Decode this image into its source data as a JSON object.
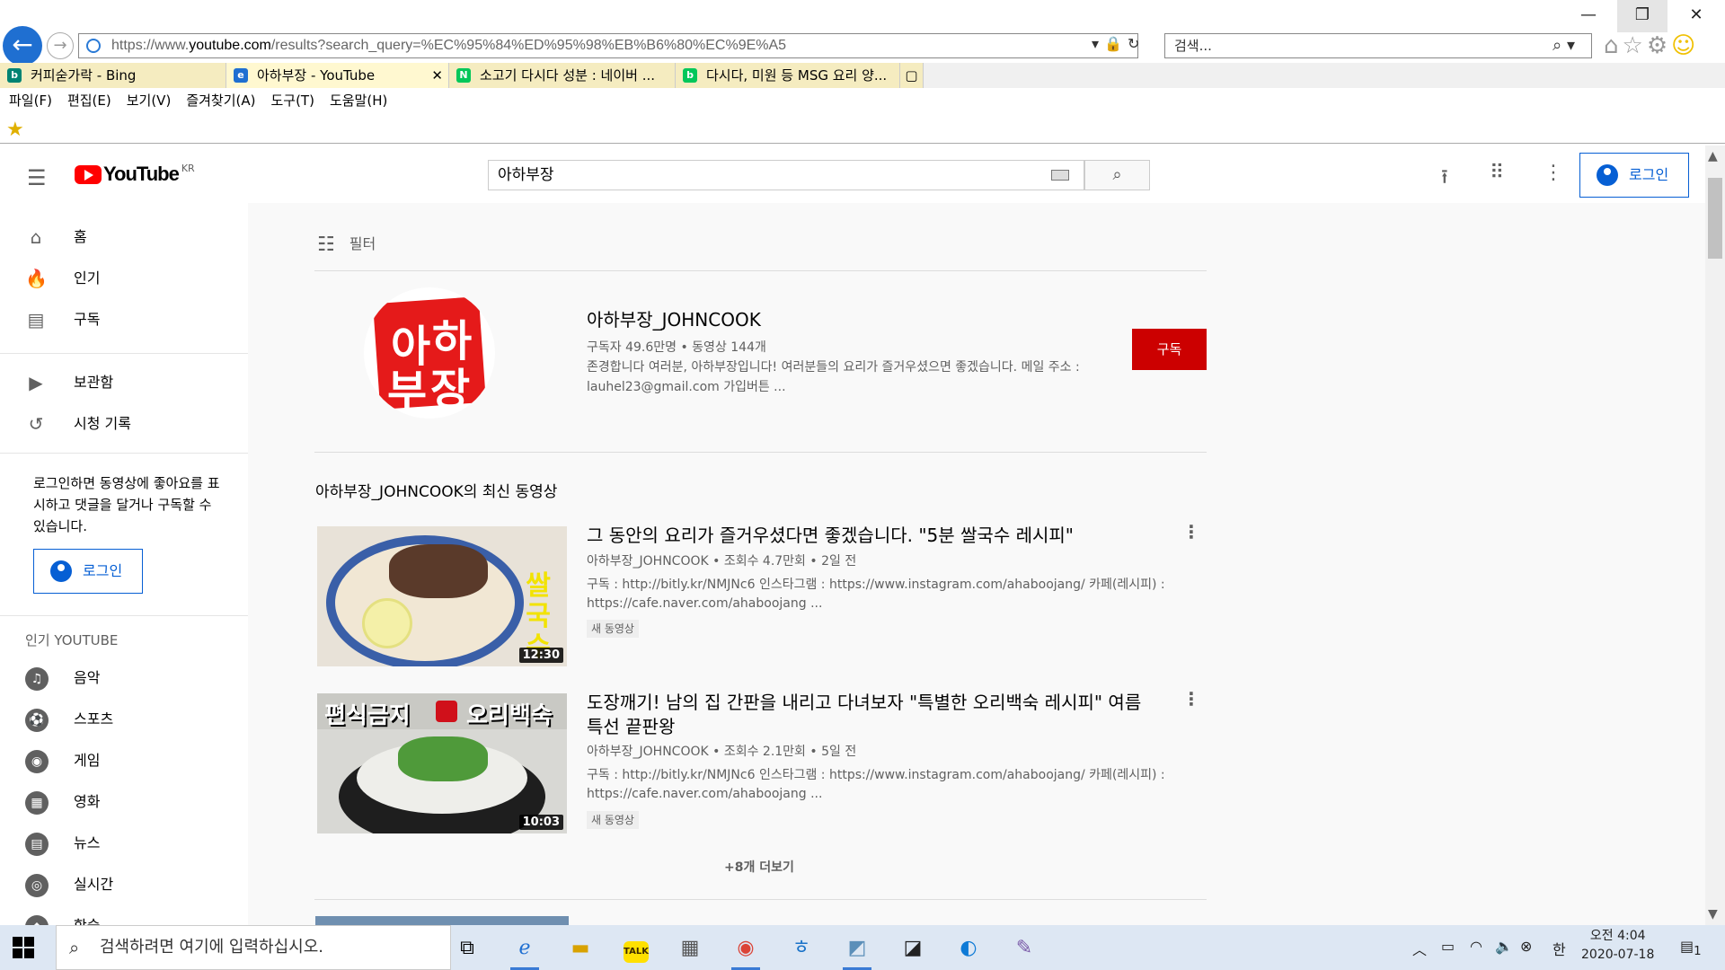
{
  "browser": {
    "url": "https://www.youtube.com/results?search_query=%EC%95%84%ED%95%98%EB%B6%80%EC%9E%A5",
    "url_scheme": "https://www.",
    "url_domain": "youtube.com",
    "url_path": "/results?search_query=%EC%95%84%ED%95%98%EB%B6%80%EC%9E%A5",
    "search_placeholder": "검색...",
    "tabs": [
      {
        "label": "커피숟가락 - Bing",
        "icon": "bing-icon",
        "color": "#008373"
      },
      {
        "label": "아하부장 - YouTube",
        "icon": "ie-icon",
        "color": "#1f6fd1"
      },
      {
        "label": "소고기 다시다 성분 : 네이버 ...",
        "icon": "naver-icon",
        "color": "#03c75a"
      },
      {
        "label": "다시다, 미원 등 MSG 요리 양...",
        "icon": "blog-icon",
        "color": "#03c75a"
      }
    ],
    "menu": [
      "파일(F)",
      "편집(E)",
      "보기(V)",
      "즐겨찾기(A)",
      "도구(T)",
      "도움말(H)"
    ]
  },
  "youtube": {
    "logo_text": "YouTube",
    "region": "KR",
    "search_value": "아하부장",
    "login_label": "로그인",
    "guide": {
      "main": [
        {
          "label": "홈",
          "icon": "home-icon",
          "glyph": "⌂"
        },
        {
          "label": "인기",
          "icon": "flame-icon",
          "glyph": "🔥"
        },
        {
          "label": "구독",
          "icon": "subscriptions-icon",
          "glyph": "▤"
        }
      ],
      "library": [
        {
          "label": "보관함",
          "icon": "library-icon",
          "glyph": "▶"
        },
        {
          "label": "시청 기록",
          "icon": "history-icon",
          "glyph": "↺"
        }
      ],
      "login_prompt": "로그인하면 동영상에 좋아요를 표시하고 댓글을 달거나 구독할 수 있습니다.",
      "login_label": "로그인",
      "popular_heading": "인기 YOUTUBE",
      "popular": [
        {
          "label": "음악",
          "icon": "music-icon",
          "glyph": "♫"
        },
        {
          "label": "스포츠",
          "icon": "sports-icon",
          "glyph": "⚽"
        },
        {
          "label": "게임",
          "icon": "gaming-icon",
          "glyph": "◉"
        },
        {
          "label": "영화",
          "icon": "movies-icon",
          "glyph": "▦"
        },
        {
          "label": "뉴스",
          "icon": "news-icon",
          "glyph": "▤"
        },
        {
          "label": "실시간",
          "icon": "live-icon",
          "glyph": "◎"
        },
        {
          "label": "학습",
          "icon": "learning-icon",
          "glyph": "◆"
        }
      ]
    },
    "filter_label": "필터",
    "channel": {
      "name": "아하부장_JOHNCOOK",
      "meta": "구독자 49.6만명 • 동영상 144개",
      "description": "존경합니다 여러분, 아하부장입니다! 여러분들의 요리가 즐거우셨으면 좋겠습니다. 메일 주소 : lauhel23@gmail.com 가입버튼 ...",
      "subscribe_label": "구독"
    },
    "latest_heading": "아하부장_JOHNCOOK의 최신 동영상",
    "videos": [
      {
        "title": "그 동안의 요리가 즐거우셨다면 좋겠습니다. \"5분 쌀국수 레시피\"",
        "meta": "아하부장_JOHNCOOK • 조회수 4.7만회 • 2일 전",
        "description": "구독 : http://bitly.kr/NMJNc6 인스타그램 : https://www.instagram.com/ahaboojang/ 카페(레시피) : https://cafe.naver.com/ahaboojang ...",
        "badge": "새 동영상",
        "duration": "12:30",
        "thumb_text": "쌀국수"
      },
      {
        "title": "도장깨기! 남의 집 간판을 내리고 다녀보자 \"특별한 오리백숙 레시피\" 여름특선 끝판왕",
        "meta": "아하부장_JOHNCOOK • 조회수 2.1만회 • 5일 전",
        "description": "구독 : http://bitly.kr/NMJNc6 인스타그램 : https://www.instagram.com/ahaboojang/ 카페(레시피) : https://cafe.naver.com/ahaboojang ...",
        "badge": "새 동영상",
        "duration": "10:03",
        "thumb_text_left": "편식금지",
        "thumb_text_right": "오리백숙"
      }
    ],
    "more_label": "+8개 더보기"
  },
  "taskbar": {
    "search_placeholder": "검색하려면 여기에 입력하십시오.",
    "time": "오전 4:04",
    "date": "2020-07-18",
    "ime": "한",
    "notif_count": "1"
  }
}
